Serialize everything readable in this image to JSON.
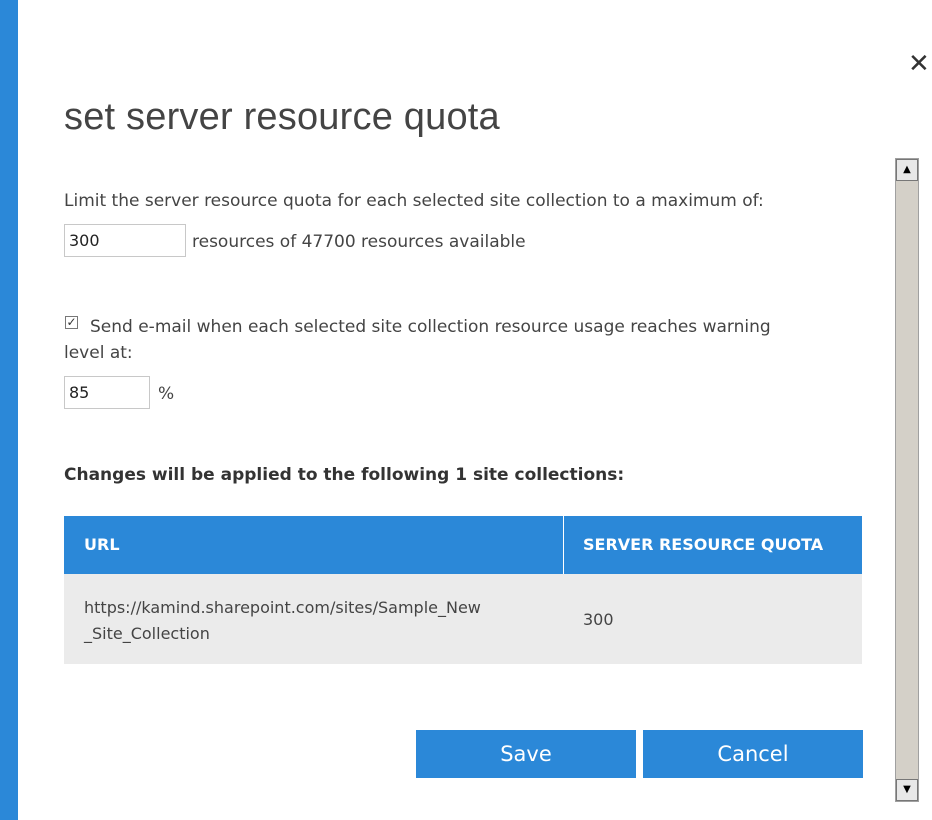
{
  "dialog": {
    "title": "set server resource quota",
    "close_symbol": "✕"
  },
  "quota": {
    "label": "Limit the server resource quota for each selected site collection to a maximum of:",
    "value": "300",
    "suffix": "resources of 47700 resources available"
  },
  "warning": {
    "checked": true,
    "check_mark": "✓",
    "label_line1": "Send e-mail when each selected site collection resource usage reaches warning",
    "label_line2": "level at:",
    "value": "85",
    "unit": "%"
  },
  "changes": {
    "heading": "Changes will be applied to the following 1 site collections:",
    "columns": [
      "URL",
      "SERVER RESOURCE QUOTA"
    ],
    "rows": [
      {
        "url_line1": "https://kamind.sharepoint.com/sites/Sample_New",
        "url_line2": "_Site_Collection",
        "quota": "300"
      }
    ]
  },
  "buttons": {
    "save": "Save",
    "cancel": "Cancel"
  },
  "scrollbar": {
    "up_arrow": "▲",
    "down_arrow": "▼"
  },
  "colors": {
    "accent": "#2b88d8",
    "row_background": "#ebebeb",
    "text": "#444444"
  }
}
